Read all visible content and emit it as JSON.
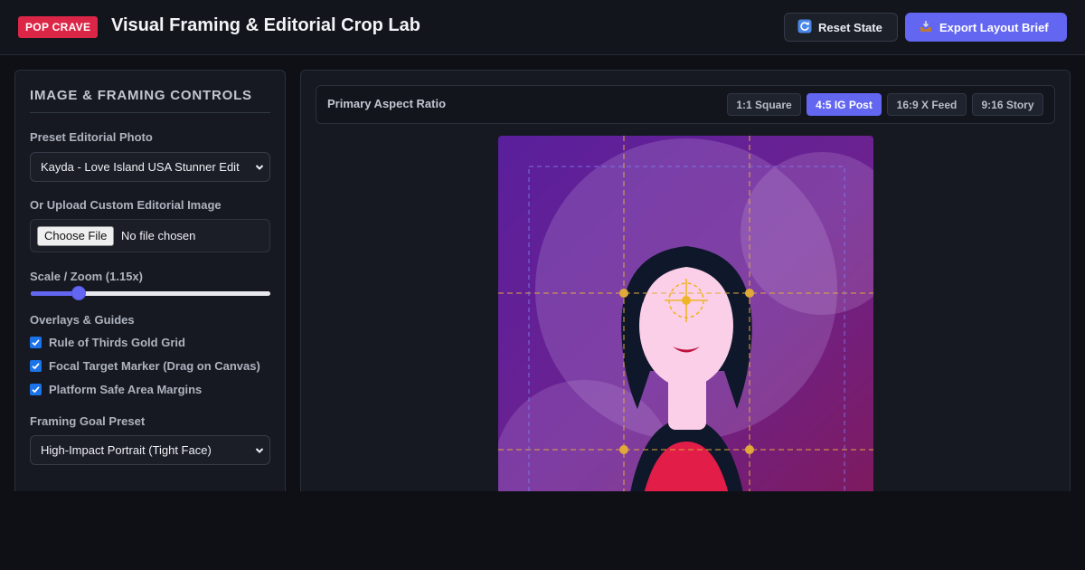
{
  "header": {
    "brand": "POP CRAVE",
    "title": "Visual Framing & Editorial Crop Lab",
    "reset_label": "Reset State",
    "export_label": "Export Layout Brief"
  },
  "sidebar": {
    "title": "IMAGE & FRAMING CONTROLS",
    "preset_label": "Preset Editorial Photo",
    "preset_value": "Kayda - Love Island USA Stunner Edit",
    "upload_label": "Or Upload Custom Editorial Image",
    "file_button": "Choose File",
    "file_status": "No file chosen",
    "zoom_label": "Scale / Zoom (1.15x)",
    "zoom_fraction": 0.2,
    "overlays_label": "Overlays & Guides",
    "overlays": [
      {
        "label": "Rule of Thirds Gold Grid",
        "checked": true
      },
      {
        "label": "Focal Target Marker (Drag on Canvas)",
        "checked": true
      },
      {
        "label": "Platform Safe Area Margins",
        "checked": true
      }
    ],
    "goal_label": "Framing Goal Preset",
    "goal_value": "High-Impact Portrait (Tight Face)"
  },
  "stage": {
    "ratio_label": "Primary Aspect Ratio",
    "tabs": [
      {
        "label": "1:1 Square",
        "active": false
      },
      {
        "label": "4:5 IG Post",
        "active": true
      },
      {
        "label": "16:9 X Feed",
        "active": false
      },
      {
        "label": "9:16 Story",
        "active": false
      }
    ]
  },
  "colors": {
    "accent": "#6366f1",
    "brand": "#dc2647",
    "grid_gold": "#e0a93a",
    "safe_area": "#7c7cf0"
  },
  "icons": {
    "reset": "refresh-icon",
    "export": "export-tray-icon"
  }
}
